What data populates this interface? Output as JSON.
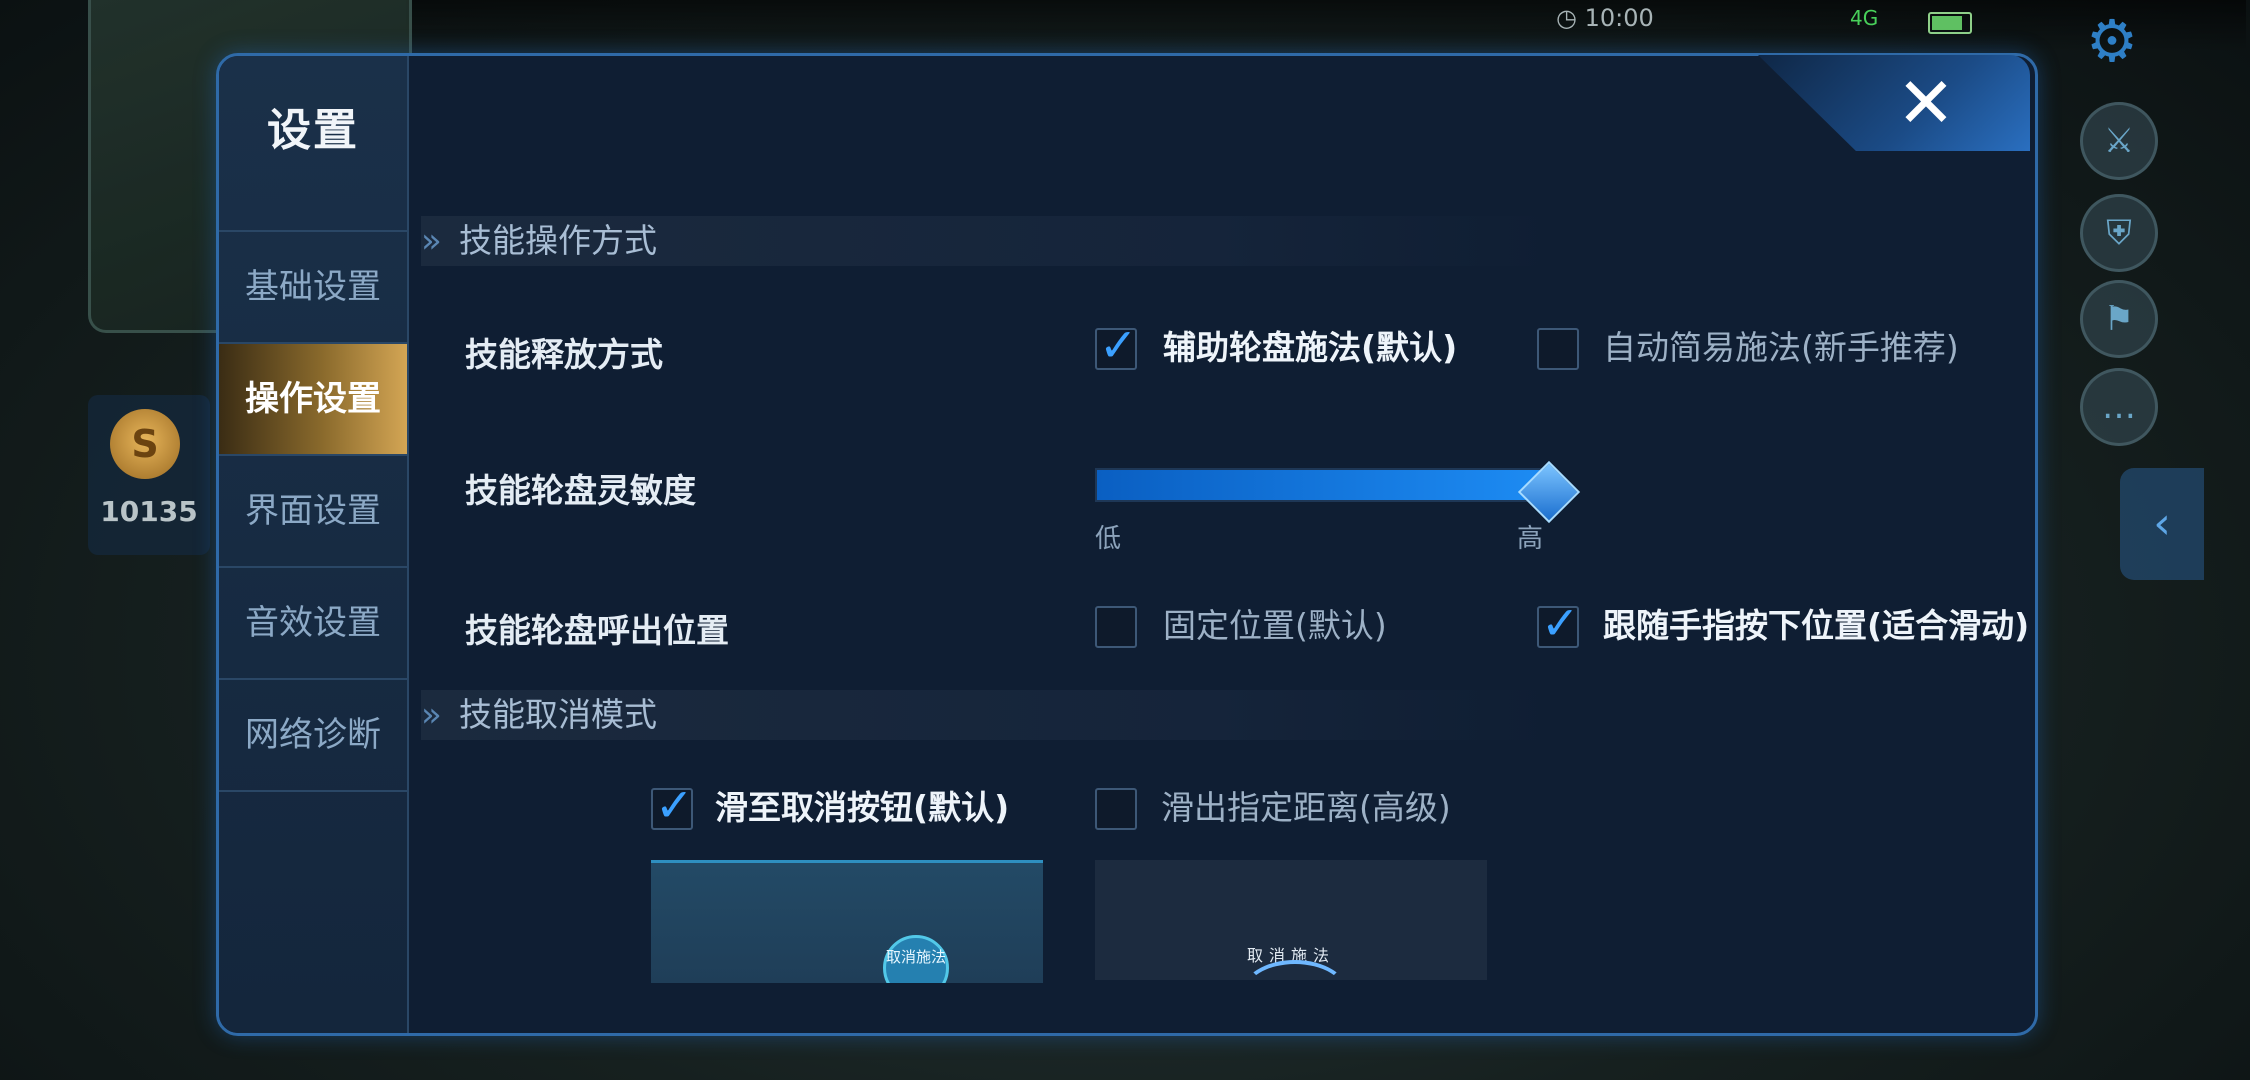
{
  "status_bar": {
    "time": "10:00",
    "network_label": "4G"
  },
  "hud": {
    "gold_amount": "10135",
    "gold_icon": "S"
  },
  "settings": {
    "title": "设置",
    "close_icon": "✕",
    "nav": [
      {
        "label": "基础设置",
        "active": false
      },
      {
        "label": "操作设置",
        "active": true
      },
      {
        "label": "界面设置",
        "active": false
      },
      {
        "label": "音效设置",
        "active": false
      },
      {
        "label": "网络诊断",
        "active": false
      }
    ],
    "skill_operation": {
      "section_title": "技能操作方式",
      "cast_mode": {
        "label": "技能释放方式",
        "options": [
          {
            "label": "辅助轮盘施法(默认)",
            "checked": true
          },
          {
            "label": "自动简易施法(新手推荐)",
            "checked": false
          }
        ]
      },
      "sensitivity": {
        "label": "技能轮盘灵敏度",
        "min_label": "低",
        "max_label": "高",
        "value": 1.0
      },
      "wheel_position": {
        "label": "技能轮盘呼出位置",
        "options": [
          {
            "label": "固定位置(默认)",
            "checked": false
          },
          {
            "label": "跟随手指按下位置(适合滑动)",
            "checked": true
          }
        ]
      }
    },
    "skill_cancel": {
      "section_title": "技能取消模式",
      "options": [
        {
          "label": "滑至取消按钮(默认)",
          "checked": true
        },
        {
          "label": "滑出指定距离(高级)",
          "checked": false
        }
      ],
      "preview_button_text": "取消施法",
      "preview_arc_text": "取消施法"
    }
  },
  "colors": {
    "accent_blue": "#1d8cf4",
    "active_tab_gold": "#d3a554",
    "panel_bg": "#0f1e33"
  }
}
